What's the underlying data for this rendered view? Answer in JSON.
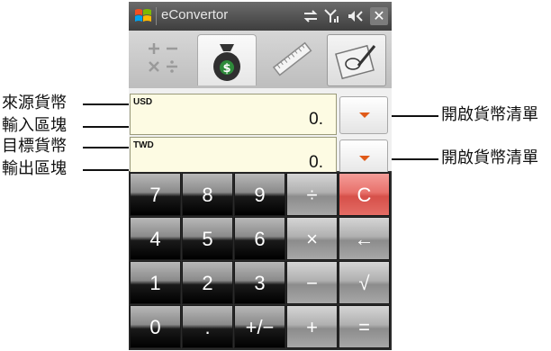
{
  "annotations": {
    "source_currency": "來源貨幣",
    "input_block": "輸入區塊",
    "target_currency": "目標貨幣",
    "output_block": "輸出區塊",
    "open_list_1": "開啟貨幣清單",
    "open_list_2": "開啟貨幣清單"
  },
  "titlebar": {
    "app_title": "eConvertor",
    "close": "✕",
    "icons": [
      "windows-logo-icon",
      "sync-icon",
      "signal-icon",
      "volume-icon",
      "close-icon"
    ]
  },
  "tabs": [
    {
      "id": "calculator",
      "icon": "math-operators-icon"
    },
    {
      "id": "currency",
      "icon": "money-bag-icon",
      "selected": true
    },
    {
      "id": "units",
      "icon": "ruler-icon"
    },
    {
      "id": "settings",
      "icon": "edit-settings-icon"
    }
  ],
  "source": {
    "code": "USD",
    "value": "0."
  },
  "target": {
    "code": "TWD",
    "value": "0."
  },
  "keys": [
    [
      "7",
      "8",
      "9",
      "÷",
      "C"
    ],
    [
      "4",
      "5",
      "6",
      "×",
      "←"
    ],
    [
      "1",
      "2",
      "3",
      "−",
      "√"
    ],
    [
      "0",
      ".",
      "+/−",
      "+",
      "="
    ]
  ],
  "colors": {
    "clear_key": "#e46c65",
    "dropdown_arrow": "#e05a18",
    "field_bg": "#fdfbe3"
  }
}
